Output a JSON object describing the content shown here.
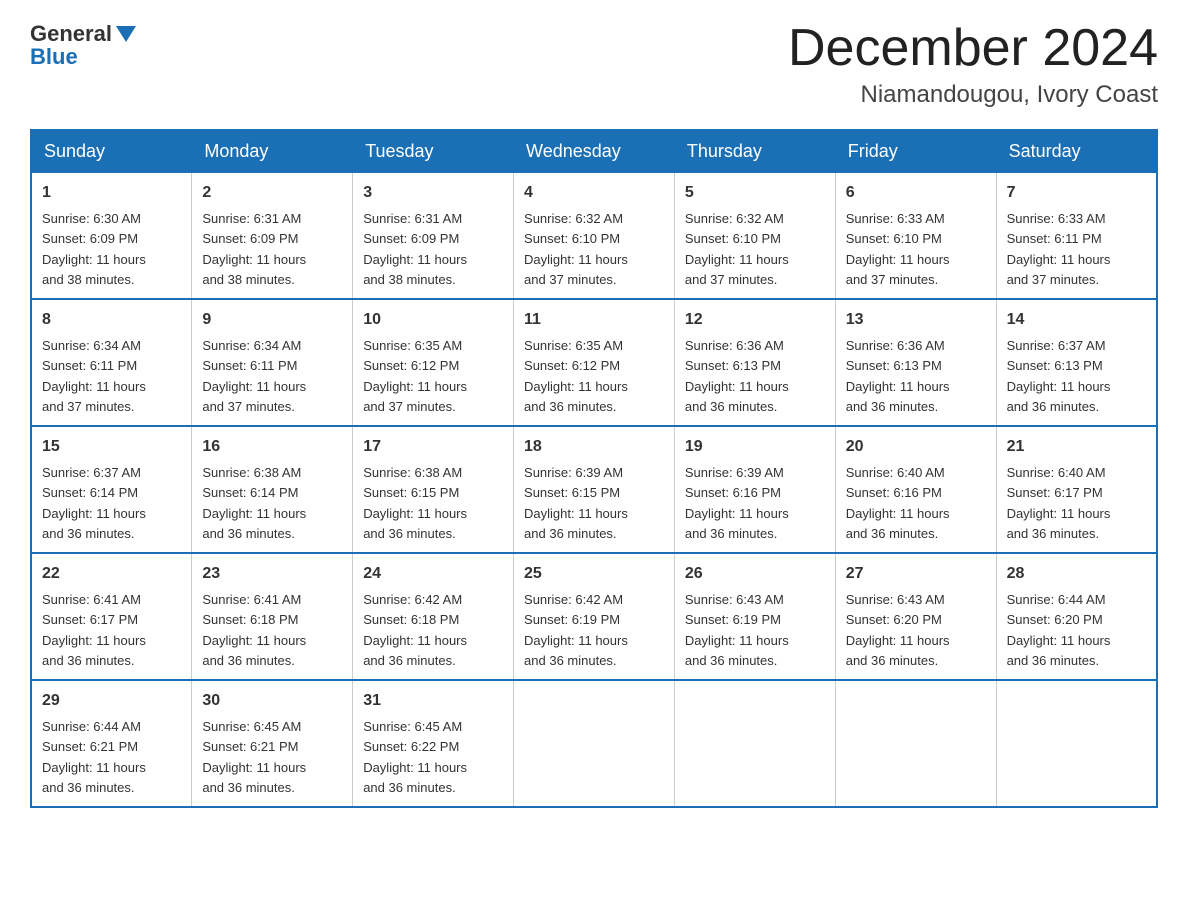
{
  "header": {
    "logo_general": "General",
    "logo_blue": "Blue",
    "month_title": "December 2024",
    "location": "Niamandougou, Ivory Coast"
  },
  "weekdays": [
    "Sunday",
    "Monday",
    "Tuesday",
    "Wednesday",
    "Thursday",
    "Friday",
    "Saturday"
  ],
  "weeks": [
    [
      {
        "day": "1",
        "sunrise": "6:30 AM",
        "sunset": "6:09 PM",
        "daylight": "11 hours and 38 minutes."
      },
      {
        "day": "2",
        "sunrise": "6:31 AM",
        "sunset": "6:09 PM",
        "daylight": "11 hours and 38 minutes."
      },
      {
        "day": "3",
        "sunrise": "6:31 AM",
        "sunset": "6:09 PM",
        "daylight": "11 hours and 38 minutes."
      },
      {
        "day": "4",
        "sunrise": "6:32 AM",
        "sunset": "6:10 PM",
        "daylight": "11 hours and 37 minutes."
      },
      {
        "day": "5",
        "sunrise": "6:32 AM",
        "sunset": "6:10 PM",
        "daylight": "11 hours and 37 minutes."
      },
      {
        "day": "6",
        "sunrise": "6:33 AM",
        "sunset": "6:10 PM",
        "daylight": "11 hours and 37 minutes."
      },
      {
        "day": "7",
        "sunrise": "6:33 AM",
        "sunset": "6:11 PM",
        "daylight": "11 hours and 37 minutes."
      }
    ],
    [
      {
        "day": "8",
        "sunrise": "6:34 AM",
        "sunset": "6:11 PM",
        "daylight": "11 hours and 37 minutes."
      },
      {
        "day": "9",
        "sunrise": "6:34 AM",
        "sunset": "6:11 PM",
        "daylight": "11 hours and 37 minutes."
      },
      {
        "day": "10",
        "sunrise": "6:35 AM",
        "sunset": "6:12 PM",
        "daylight": "11 hours and 37 minutes."
      },
      {
        "day": "11",
        "sunrise": "6:35 AM",
        "sunset": "6:12 PM",
        "daylight": "11 hours and 36 minutes."
      },
      {
        "day": "12",
        "sunrise": "6:36 AM",
        "sunset": "6:13 PM",
        "daylight": "11 hours and 36 minutes."
      },
      {
        "day": "13",
        "sunrise": "6:36 AM",
        "sunset": "6:13 PM",
        "daylight": "11 hours and 36 minutes."
      },
      {
        "day": "14",
        "sunrise": "6:37 AM",
        "sunset": "6:13 PM",
        "daylight": "11 hours and 36 minutes."
      }
    ],
    [
      {
        "day": "15",
        "sunrise": "6:37 AM",
        "sunset": "6:14 PM",
        "daylight": "11 hours and 36 minutes."
      },
      {
        "day": "16",
        "sunrise": "6:38 AM",
        "sunset": "6:14 PM",
        "daylight": "11 hours and 36 minutes."
      },
      {
        "day": "17",
        "sunrise": "6:38 AM",
        "sunset": "6:15 PM",
        "daylight": "11 hours and 36 minutes."
      },
      {
        "day": "18",
        "sunrise": "6:39 AM",
        "sunset": "6:15 PM",
        "daylight": "11 hours and 36 minutes."
      },
      {
        "day": "19",
        "sunrise": "6:39 AM",
        "sunset": "6:16 PM",
        "daylight": "11 hours and 36 minutes."
      },
      {
        "day": "20",
        "sunrise": "6:40 AM",
        "sunset": "6:16 PM",
        "daylight": "11 hours and 36 minutes."
      },
      {
        "day": "21",
        "sunrise": "6:40 AM",
        "sunset": "6:17 PM",
        "daylight": "11 hours and 36 minutes."
      }
    ],
    [
      {
        "day": "22",
        "sunrise": "6:41 AM",
        "sunset": "6:17 PM",
        "daylight": "11 hours and 36 minutes."
      },
      {
        "day": "23",
        "sunrise": "6:41 AM",
        "sunset": "6:18 PM",
        "daylight": "11 hours and 36 minutes."
      },
      {
        "day": "24",
        "sunrise": "6:42 AM",
        "sunset": "6:18 PM",
        "daylight": "11 hours and 36 minutes."
      },
      {
        "day": "25",
        "sunrise": "6:42 AM",
        "sunset": "6:19 PM",
        "daylight": "11 hours and 36 minutes."
      },
      {
        "day": "26",
        "sunrise": "6:43 AM",
        "sunset": "6:19 PM",
        "daylight": "11 hours and 36 minutes."
      },
      {
        "day": "27",
        "sunrise": "6:43 AM",
        "sunset": "6:20 PM",
        "daylight": "11 hours and 36 minutes."
      },
      {
        "day": "28",
        "sunrise": "6:44 AM",
        "sunset": "6:20 PM",
        "daylight": "11 hours and 36 minutes."
      }
    ],
    [
      {
        "day": "29",
        "sunrise": "6:44 AM",
        "sunset": "6:21 PM",
        "daylight": "11 hours and 36 minutes."
      },
      {
        "day": "30",
        "sunrise": "6:45 AM",
        "sunset": "6:21 PM",
        "daylight": "11 hours and 36 minutes."
      },
      {
        "day": "31",
        "sunrise": "6:45 AM",
        "sunset": "6:22 PM",
        "daylight": "11 hours and 36 minutes."
      },
      null,
      null,
      null,
      null
    ]
  ],
  "labels": {
    "sunrise": "Sunrise:",
    "sunset": "Sunset:",
    "daylight": "Daylight:"
  }
}
